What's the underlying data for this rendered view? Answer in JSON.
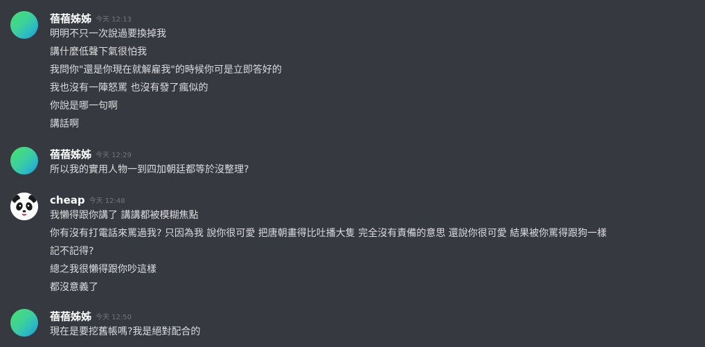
{
  "messages": [
    {
      "username": "蓓蓓姊姊",
      "timestamp": "今天 12:13",
      "avatar": "gradient-avatar",
      "lines": [
        "明明不只一次說過要換掉我",
        "講什麼低聲下氣很怕我",
        "我問你\"還是你現在就解雇我\"的時候你可是立即答好的",
        "我也沒有一陣怒罵 也沒有發了瘋似的",
        "你說是哪一句啊",
        "講話啊"
      ]
    },
    {
      "username": "蓓蓓姊姊",
      "timestamp": "今天 12:29",
      "avatar": "gradient-avatar",
      "lines": [
        "所以我的實用人物一到四加朝廷都等於沒整理?"
      ]
    },
    {
      "username": "cheap",
      "timestamp": "今天 12:48",
      "avatar": "panda-avatar",
      "lines": [
        "我懶得跟你講了 講講都被模糊焦點",
        "你有沒有打電話來罵過我? 只因為我 說你很可愛 把唐朝畫得比吐播大隻 完全沒有責備的意思 還說你很可愛 結果被你罵得跟狗一樣",
        "記不記得?",
        "總之我很懶得跟你吵這樣",
        "都沒意義了"
      ]
    },
    {
      "username": "蓓蓓姊姊",
      "timestamp": "今天 12:50",
      "avatar": "gradient-avatar",
      "lines": [
        "現在是要挖舊帳嗎?我是絕對配合的"
      ]
    }
  ],
  "colors": {
    "background": "#36393f",
    "username": "#ffffff",
    "timestamp": "#72767d",
    "text": "#dcddde"
  }
}
